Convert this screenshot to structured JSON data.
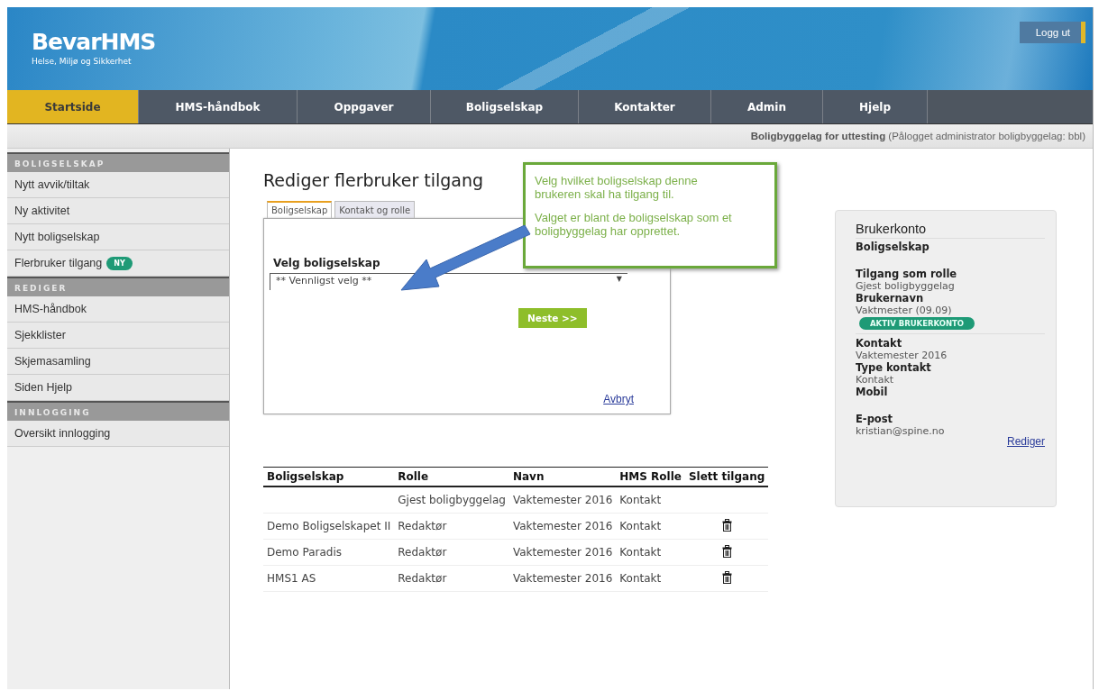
{
  "header": {
    "logo": "BevarHMS",
    "tagline": "Helse, Miljø og Sikkerhet",
    "logout": "Logg ut"
  },
  "nav": [
    {
      "label": "Startside",
      "selected": true
    },
    {
      "label": "HMS-håndbok",
      "selected": false
    },
    {
      "label": "Oppgaver",
      "selected": false
    },
    {
      "label": "Boligselskap",
      "selected": false
    },
    {
      "label": "Kontakter",
      "selected": false
    },
    {
      "label": "Admin",
      "selected": false
    },
    {
      "label": "Hjelp",
      "selected": false
    }
  ],
  "status_bar": {
    "organization": "Boligbyggelag for uttesting",
    "login_info": "(Pålogget administrator boligbyggelag: bbl)"
  },
  "sidebar": [
    {
      "heading": "BOLIGSELSKAP",
      "items": [
        {
          "label": "Nytt avvik/tiltak"
        },
        {
          "label": "Ny aktivitet"
        },
        {
          "label": "Nytt boligselskap"
        },
        {
          "label": "Flerbruker tilgang",
          "badge": "NY"
        }
      ]
    },
    {
      "heading": "REDIGER",
      "items": [
        {
          "label": "HMS-håndbok"
        },
        {
          "label": "Sjekklister"
        },
        {
          "label": "Skjemasamling"
        },
        {
          "label": "Siden Hjelp"
        }
      ]
    },
    {
      "heading": "INNLOGGING",
      "items": [
        {
          "label": "Oversikt innlogging"
        }
      ]
    }
  ],
  "page_title": "Rediger flerbruker tilgang",
  "form_tabs": [
    {
      "label": "Boligselskap",
      "selected": true
    },
    {
      "label": "Kontakt og rolle",
      "selected": false
    }
  ],
  "form": {
    "field_label": "Velg boligselskap",
    "select_value": "** Vennligst velg **",
    "select_caret": "▼",
    "next_button": "Neste >>",
    "cancel_link": "Avbryt"
  },
  "callout": [
    "Velg hvilket boligselskap denne brukeren skal ha tilgang til.",
    "Valget er blant de boligselskap som et boligbyggelag har opprettet."
  ],
  "table": {
    "columns": [
      "Boligselskap",
      "Rolle",
      "Navn",
      "HMS Rolle",
      "Slett tilgang"
    ],
    "rows": [
      {
        "cells": [
          "",
          "Gjest boligbyggelag",
          "Vaktemester 2016",
          "Kontakt"
        ],
        "deletable": false
      },
      {
        "cells": [
          "Demo Boligselskapet II",
          "Redaktør",
          "Vaktemester 2016",
          "Kontakt"
        ],
        "deletable": true
      },
      {
        "cells": [
          "Demo Paradis",
          "Redaktør",
          "Vaktemester 2016",
          "Kontakt"
        ],
        "deletable": true
      },
      {
        "cells": [
          "HMS1 AS",
          "Redaktør",
          "Vaktemester 2016",
          "Kontakt"
        ],
        "deletable": true
      }
    ]
  },
  "account_card": {
    "title": "Brukerkonto",
    "entries": [
      {
        "kind": "field",
        "label": "Boligselskap"
      },
      {
        "kind": "field",
        "label": "Tilgang som rolle",
        "value": "Gjest boligbyggelag"
      },
      {
        "kind": "field",
        "label": "Brukernavn",
        "value": "Vaktmester (09.09)"
      },
      {
        "kind": "badge",
        "text": "AKTIV BRUKERKONTO"
      },
      {
        "kind": "rule"
      },
      {
        "kind": "field",
        "label": "Kontakt",
        "value": "Vaktemester 2016"
      },
      {
        "kind": "field",
        "label": "Type kontakt",
        "value": "Kontakt"
      },
      {
        "kind": "field",
        "label": "Mobil"
      },
      {
        "kind": "field",
        "label": "E-post",
        "value": "kristian@spine.no"
      }
    ],
    "edit_link": "Rediger"
  }
}
